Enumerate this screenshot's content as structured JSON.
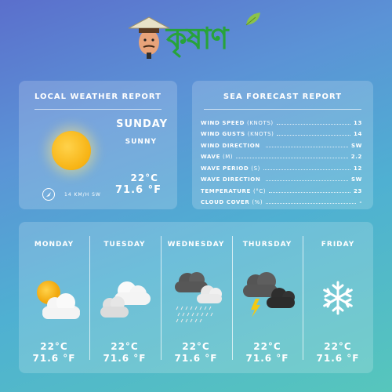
{
  "brand": {
    "name": "কৃষাণ",
    "logo_color": "#27a33a"
  },
  "local": {
    "title": "LOCAL WEATHER REPORT",
    "day": "SUNDAY",
    "condition": "SUNNY",
    "temp_c": "22°C",
    "temp_f": "71.6 °F",
    "wind": "14 KM/H SW",
    "icon": "sun-icon"
  },
  "sea": {
    "title": "SEA FORECAST REPORT",
    "rows": [
      {
        "label": "WIND SPEED",
        "unit": "(KNOTS)",
        "value": "13"
      },
      {
        "label": "WIND GUSTS",
        "unit": "(KNOTS)",
        "value": "14"
      },
      {
        "label": "WIND DIRECTION",
        "unit": "",
        "value": "SW"
      },
      {
        "label": "WAVE",
        "unit": "(M)",
        "value": "2.2"
      },
      {
        "label": "WAVE PERIOD",
        "unit": "(S)",
        "value": "12"
      },
      {
        "label": "WAVE DIRECTION",
        "unit": "",
        "value": "SW"
      },
      {
        "label": "TEMPERATURE",
        "unit": "(°C)",
        "value": "23"
      },
      {
        "label": "CLOUD COVER",
        "unit": "(%)",
        "value": "-"
      }
    ]
  },
  "week": [
    {
      "day": "MONDAY",
      "icon": "partly-cloudy-icon",
      "temp_c": "22°C",
      "temp_f": "71.6 °F"
    },
    {
      "day": "TUESDAY",
      "icon": "cloudy-icon",
      "temp_c": "22°C",
      "temp_f": "71.6 °F"
    },
    {
      "day": "WEDNESDAY",
      "icon": "rain-icon",
      "temp_c": "22°C",
      "temp_f": "71.6 °F"
    },
    {
      "day": "THURSDAY",
      "icon": "thunderstorm-icon",
      "temp_c": "22°C",
      "temp_f": "71.6 °F"
    },
    {
      "day": "FRIDAY",
      "icon": "snow-icon",
      "temp_c": "22°C",
      "temp_f": "71.6 °F"
    }
  ]
}
